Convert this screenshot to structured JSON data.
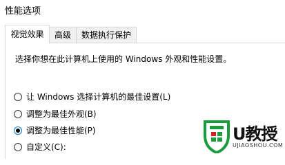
{
  "window": {
    "title": "性能选项"
  },
  "tabs": [
    {
      "label": "视觉效果",
      "active": true
    },
    {
      "label": "高级",
      "active": false
    },
    {
      "label": "数据执行保护",
      "active": false
    }
  ],
  "visual_effects": {
    "description": "选择你想在此计算机上使用的 Windows 外观和性能设置。",
    "options": [
      {
        "label": "让 Windows 选择计算机的最佳设置(L)",
        "checked": false
      },
      {
        "label": "调整为最佳外观(B)",
        "checked": false
      },
      {
        "label": "调整为最佳性能(P)",
        "checked": true
      },
      {
        "label": "自定义(C):",
        "checked": false
      }
    ]
  },
  "watermark": {
    "brand": "U教授",
    "url": "UJIAOSHOU.COM",
    "colors": {
      "shield_green": "#1a9b3c",
      "shield_red": "#d81e1e",
      "text": "#111111"
    }
  },
  "colors": {
    "tab_inactive": "#f0f0f0",
    "border": "#d9d9d9",
    "radio_focus": "#0078d7"
  }
}
